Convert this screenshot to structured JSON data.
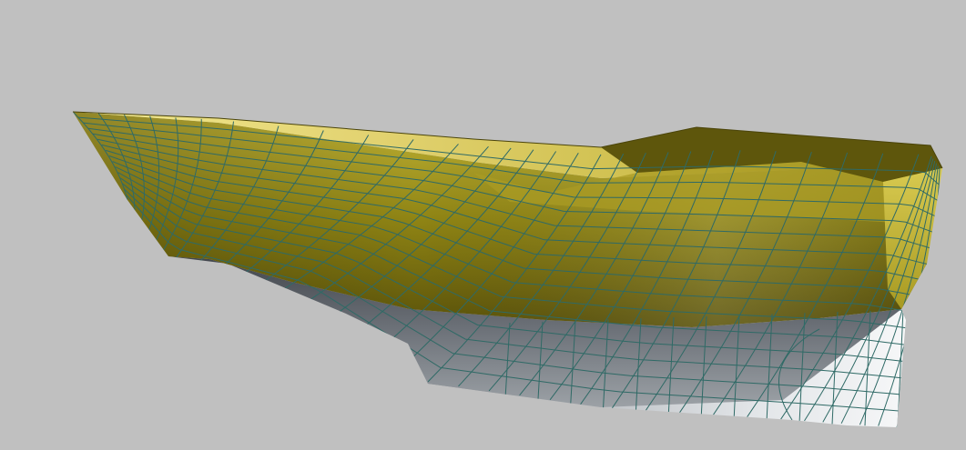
{
  "scene": {
    "subject": "hull-wireframe-render",
    "colors": {
      "background": "#c0c0c0",
      "deck_light": "#eee48c",
      "deck_mid": "#c6b63e",
      "topside_light": "#bdb032",
      "topside_dark": "#5c5408",
      "underbody_light": "#8a8f96",
      "underbody_dark": "#3c4046",
      "keel_light": "#f2f4f6",
      "keel_dark": "#6a6e72",
      "mesh_line": "#2f6a66"
    }
  }
}
